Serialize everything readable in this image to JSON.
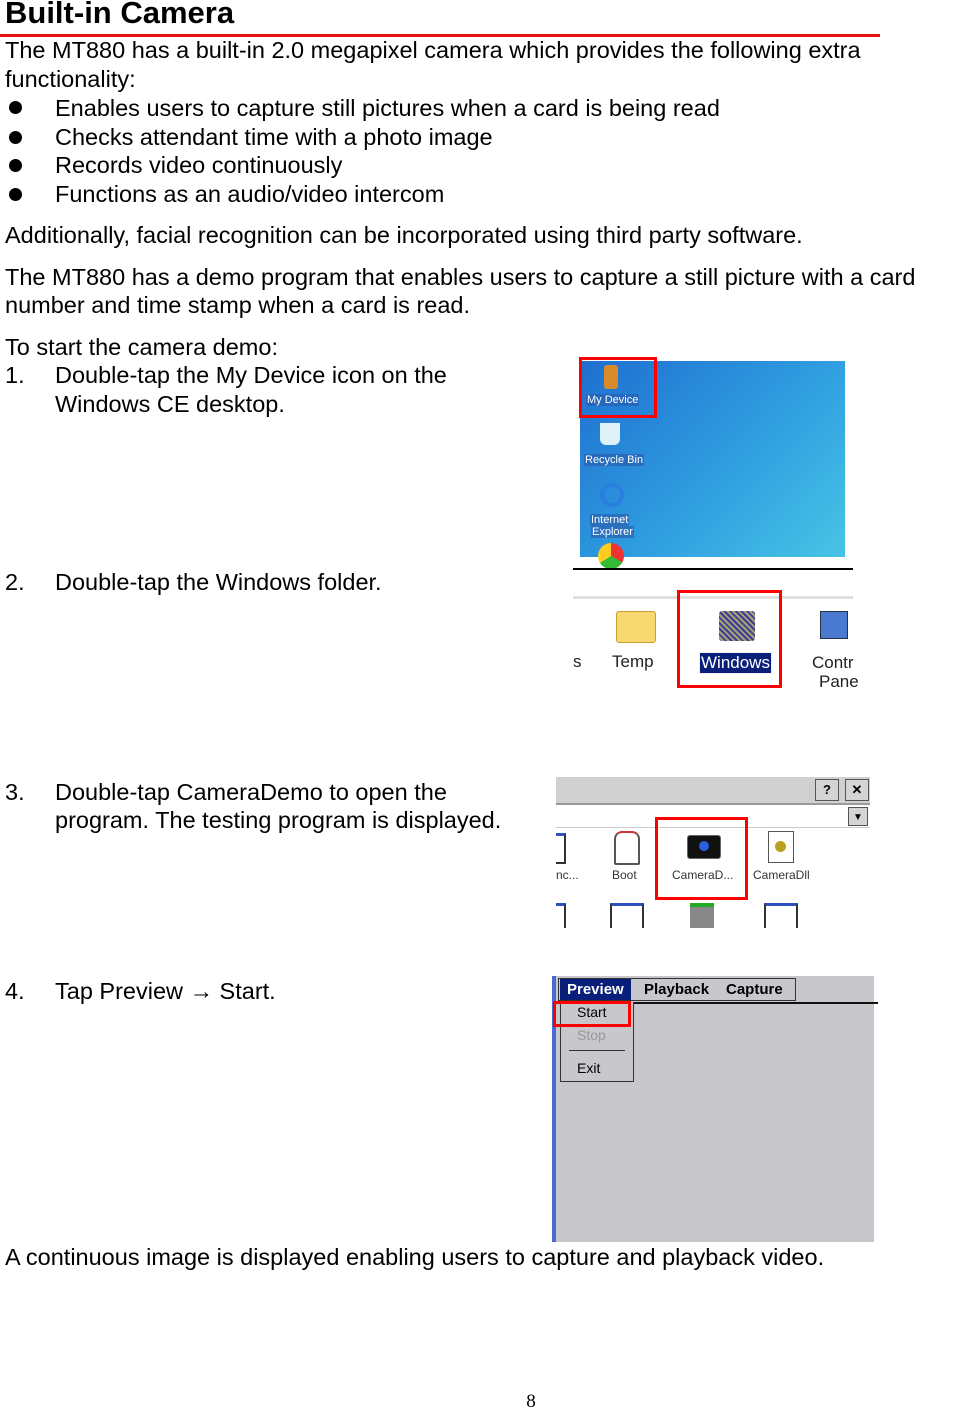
{
  "title": "Built-in Camera",
  "intro": [
    "The MT880 has a built-in 2.0 megapixel camera which provides the following extra",
    "functionality:"
  ],
  "bullets": [
    "Enables users to capture still pictures when a card is being read",
    "Checks attendant time with a photo image",
    "Records video continuously",
    "Functions as an audio/video intercom"
  ],
  "additional": "Additionally, facial recognition can be incorporated using third party software.",
  "demo": [
    "The MT880 has a demo program that enables users to capture a still picture with a card",
    "number and time stamp when a card is read."
  ],
  "start_heading": "To start the camera demo:",
  "steps": [
    {
      "num": "1.",
      "lines": [
        "Double-tap the My Device icon on the",
        "Windows CE desktop."
      ]
    },
    {
      "num": "2.",
      "lines": [
        "Double-tap the Windows folder."
      ]
    },
    {
      "num": "3.",
      "lines": [
        "Double-tap CameraDemo to open the",
        "program. The testing program is displayed."
      ]
    },
    {
      "num": "4.",
      "lines": [
        "Tap Preview  →  Start."
      ]
    }
  ],
  "closing": "A continuous image is displayed enabling users to capture and playback video.",
  "page_number": "8",
  "shot1": {
    "icons": [
      "My Device",
      "Recycle Bin",
      "Internet",
      "Explorer"
    ]
  },
  "shot2": {
    "items": [
      "s",
      "Temp",
      "Windows",
      "Contr",
      "Pane"
    ]
  },
  "shot3": {
    "help": "?",
    "close": "✕",
    "items": [
      "nc...",
      "Boot",
      "CameraD...",
      "CameraDll"
    ]
  },
  "shot4": {
    "menus": [
      "Preview",
      "Playback",
      "Capture"
    ],
    "dropdown": [
      "Start",
      "Stop",
      "Exit"
    ]
  },
  "colors": {
    "rule": "#e81010",
    "highlight": "#ff0000",
    "selection": "#0a1f7a"
  }
}
